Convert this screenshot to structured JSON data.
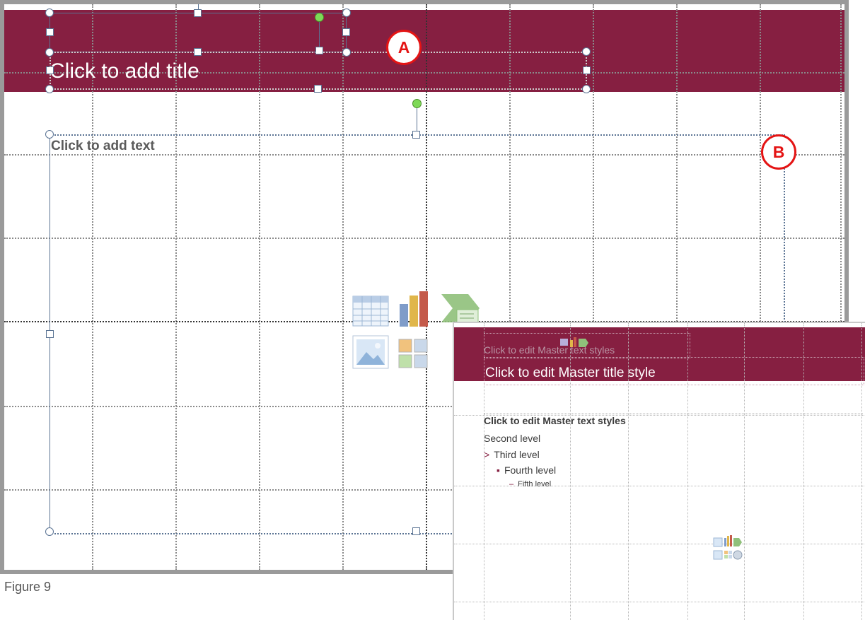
{
  "slide": {
    "title_placeholder": "Click to add title",
    "body_placeholder": "Click to add text",
    "accent_color": "#861f41",
    "content_icons": [
      "insert-table-icon",
      "insert-chart-icon",
      "insert-smartart-icon",
      "insert-picture-icon",
      "insert-clip-art-icon",
      "insert-media-icon"
    ]
  },
  "callouts": {
    "a": "A",
    "b": "B"
  },
  "caption": "Figure 9",
  "master": {
    "title": "Click to edit Master title style",
    "ghost_text": "Click to edit Master text styles",
    "levels": [
      "Click to edit Master text styles",
      "Second level",
      "Third level",
      "Fourth level",
      "Fifth level"
    ],
    "bullets": {
      "third": ">",
      "fourth": "▪",
      "fifth": "–"
    },
    "accent_color": "#861f41"
  }
}
